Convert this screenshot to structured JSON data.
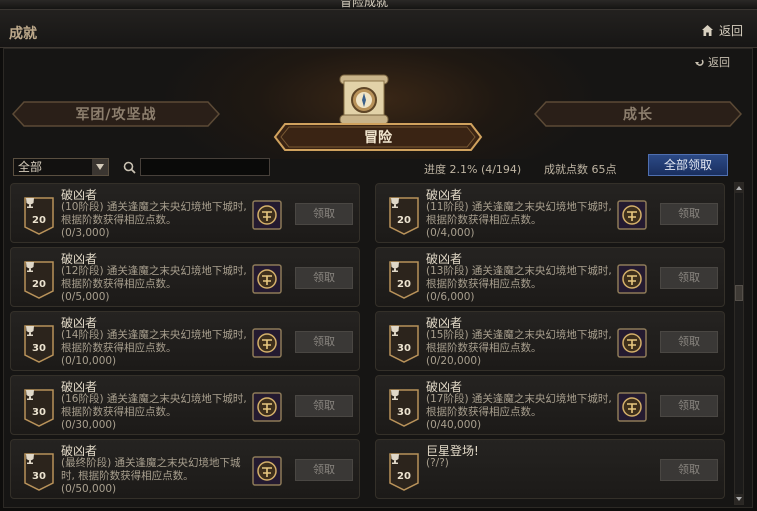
{
  "window": {
    "title": "冒险成就"
  },
  "header": {
    "title": "成就",
    "back_label": "返回"
  },
  "sub": {
    "back_label": "返回"
  },
  "categories": {
    "left": "军团/攻坚战",
    "center": "冒险",
    "right": "成长"
  },
  "filter": {
    "selected": "全部",
    "search_placeholder": ""
  },
  "status": {
    "progress": "进度  2.1% (4/194)",
    "points": "成就点数 65点",
    "claim_all": "全部领取"
  },
  "colors": {
    "accent_blue": "#2c4a86",
    "gold_frame": "#b8925a",
    "card_bg": "#1f1d1b"
  },
  "cards": [
    {
      "title": "破凶者",
      "desc": "(10阶段) 通关逢魔之末央幻境地下城时, 根据阶数获得相应点数。",
      "count": "(0/3,000)",
      "points": "20",
      "button": "领取",
      "has_reward": true
    },
    {
      "title": "破凶者",
      "desc": "(11阶段) 通关逢魔之末央幻境地下城时, 根据阶数获得相应点数。",
      "count": "(0/4,000)",
      "points": "20",
      "button": "领取",
      "has_reward": true
    },
    {
      "title": "破凶者",
      "desc": "(12阶段) 通关逢魔之末央幻境地下城时, 根据阶数获得相应点数。",
      "count": "(0/5,000)",
      "points": "20",
      "button": "领取",
      "has_reward": true
    },
    {
      "title": "破凶者",
      "desc": "(13阶段) 通关逢魔之末央幻境地下城时, 根据阶数获得相应点数。",
      "count": "(0/6,000)",
      "points": "20",
      "button": "领取",
      "has_reward": true
    },
    {
      "title": "破凶者",
      "desc": "(14阶段) 通关逢魔之末央幻境地下城时, 根据阶数获得相应点数。",
      "count": "(0/10,000)",
      "points": "30",
      "button": "领取",
      "has_reward": true
    },
    {
      "title": "破凶者",
      "desc": "(15阶段) 通关逢魔之末央幻境地下城时, 根据阶数获得相应点数。",
      "count": "(0/20,000)",
      "points": "30",
      "button": "领取",
      "has_reward": true
    },
    {
      "title": "破凶者",
      "desc": "(16阶段) 通关逢魔之末央幻境地下城时, 根据阶数获得相应点数。",
      "count": "(0/30,000)",
      "points": "30",
      "button": "领取",
      "has_reward": true
    },
    {
      "title": "破凶者",
      "desc": "(17阶段) 通关逢魔之末央幻境地下城时, 根据阶数获得相应点数。",
      "count": "(0/40,000)",
      "points": "30",
      "button": "领取",
      "has_reward": true
    },
    {
      "title": "破凶者",
      "desc": "(最终阶段) 通关逢魔之末央幻境地下城时, 根据阶数获得相应点数。",
      "count": "(0/50,000)",
      "points": "30",
      "button": "领取",
      "has_reward": true
    },
    {
      "title": "巨星登场!",
      "desc": "(?/?)",
      "count": "",
      "points": "20",
      "button": "领取",
      "has_reward": false
    }
  ]
}
